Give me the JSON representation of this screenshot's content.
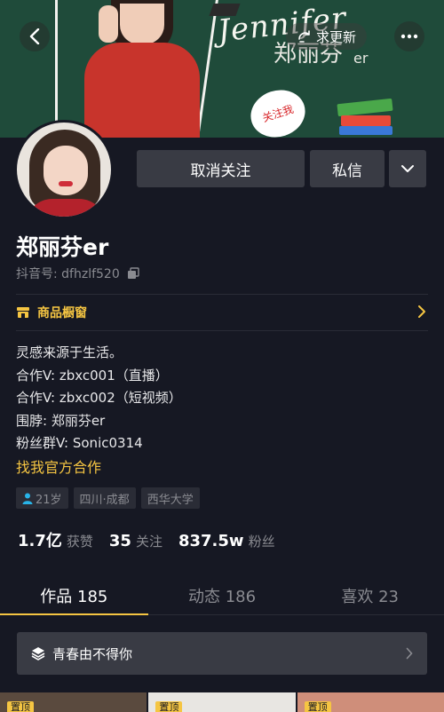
{
  "banner": {
    "art_name": "Jennifer",
    "art_name_cn": "郑丽芬",
    "art_name_suffix": "er",
    "follow_bubble": "关注我",
    "refresh_label": "求更新"
  },
  "profile": {
    "nickname": "郑丽芬er",
    "douyin_id": "抖音号: dfhzlf520",
    "unfollow_label": "取消关注",
    "message_label": "私信",
    "shop_label": "商品橱窗",
    "bio": [
      "灵感来源于生活。",
      "合作V: zbxc001（直播）",
      "合作V: zbxc002（短视频）",
      "围脖: 郑丽芬er",
      "粉丝群V: Sonic0314"
    ],
    "official_link": "找我官方合作",
    "tags": {
      "age": "21岁",
      "location": "四川·成都",
      "school": "西华大学"
    },
    "stats": {
      "likes_num": "1.7亿",
      "likes_label": "获赞",
      "following_num": "35",
      "following_label": "关注",
      "followers_num": "837.5w",
      "followers_label": "粉丝"
    }
  },
  "tabs": [
    {
      "label": "作品 185",
      "active": true
    },
    {
      "label": "动态 186",
      "active": false
    },
    {
      "label": "喜欢 23",
      "active": false
    }
  ],
  "collection": {
    "label": "青春由不得你"
  },
  "thumbs": {
    "pin_label": "置顶"
  },
  "colors": {
    "background": "#161823",
    "accent": "#f5c542",
    "button": "#393b44",
    "muted_text": "#8a8b91",
    "age_icon": "#28b4e8"
  },
  "icons": [
    "back-icon",
    "more-icon",
    "refresh-icon",
    "copy-icon",
    "chevron-down-icon",
    "shop-icon",
    "chevron-right-icon",
    "person-icon",
    "layers-icon"
  ]
}
